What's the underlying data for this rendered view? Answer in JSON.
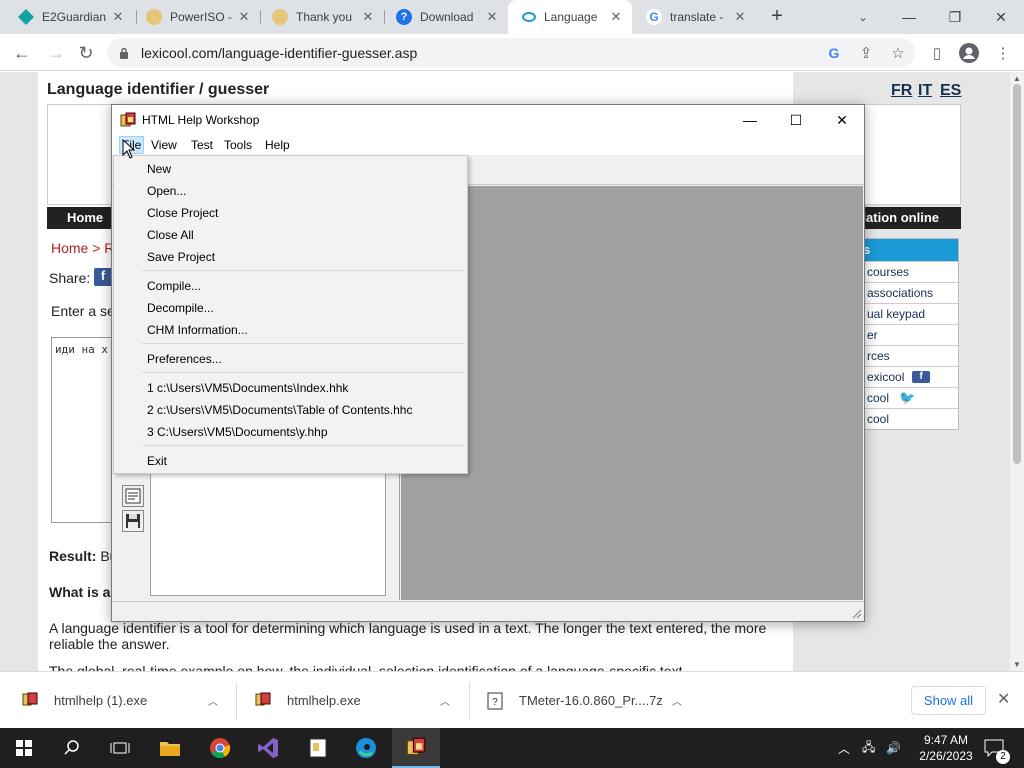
{
  "browser": {
    "tabs": [
      {
        "title": "E2Guardian",
        "favicon_color": "#0fa5a0",
        "active": false
      },
      {
        "title": "PowerISO -",
        "favicon_color": "#d8b460",
        "active": false
      },
      {
        "title": "Thank you",
        "favicon_color": "#d8b460",
        "active": false
      },
      {
        "title": "Download",
        "favicon_color": "#1a73e8",
        "active": false
      },
      {
        "title": "Language",
        "favicon_color": "#1a9ad6",
        "active": true
      },
      {
        "title": "translate -",
        "favicon_color": "#4285f4",
        "active": false
      }
    ],
    "new_tab_label": "+",
    "url": "lexicool.com/language-identifier-guesser.asp"
  },
  "page": {
    "title": "Language identifier / guesser",
    "lang_links": [
      "FR",
      "IT",
      "ES"
    ],
    "nav_home": "Home",
    "nav_right": "lation online",
    "breadcrumb": "Home > R",
    "share_label": "Share:",
    "enter_text": "Enter a se",
    "textarea_value": "иди на х",
    "result_label": "Result:",
    "result_value": "Bu",
    "what_is": "What is a",
    "paragraph": "A language identifier is a tool for determining which language is used in a text. The longer the text entered, the more reliable the answer.",
    "paragraph2": "The global, real-time example on how, the individual, selection identification of a language-specific text",
    "sidebar": {
      "header": "s",
      "items": [
        "courses",
        "associations",
        "ual keypad",
        "er",
        "rces",
        "exicool",
        "cool",
        "cool"
      ]
    }
  },
  "hhw": {
    "title": "HTML Help Workshop",
    "menu": [
      "File",
      "View",
      "Test",
      "Tools",
      "Help"
    ],
    "file_menu": {
      "group1": [
        "New",
        "Open...",
        "Close Project",
        "Close All",
        "Save Project"
      ],
      "group2": [
        "Compile...",
        "Decompile...",
        "CHM Information..."
      ],
      "group3": [
        "Preferences..."
      ],
      "recent": [
        "1 c:\\Users\\VM5\\Documents\\Index.hhk",
        "2 c:\\Users\\VM5\\Documents\\Table of Contents.hhc",
        "3 C:\\Users\\VM5\\Documents\\y.hhp"
      ],
      "exit": "Exit"
    }
  },
  "downloads": {
    "items": [
      "htmlhelp (1).exe",
      "htmlhelp.exe",
      "TMeter-16.0.860_Pr....7z"
    ],
    "show_all": "Show all"
  },
  "taskbar": {
    "time": "9:47 AM",
    "date": "2/26/2023",
    "notification_count": "2"
  }
}
